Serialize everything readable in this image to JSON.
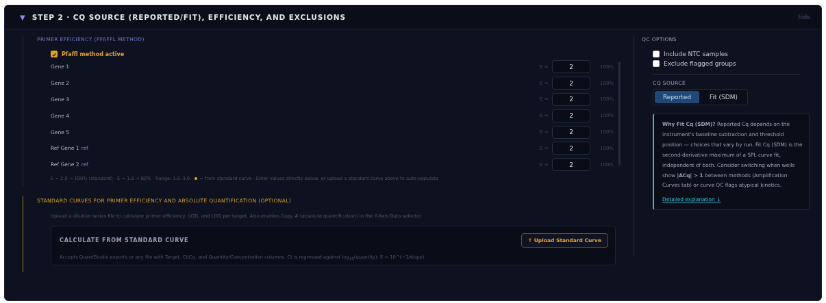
{
  "section": {
    "arrow": "▼",
    "title": "STEP 2 · CQ SOURCE (REPORTED/FIT), EFFICIENCY, AND EXCLUSIONS",
    "hide_link": "hide",
    "expanded": true
  },
  "primer_efficiency": {
    "heading": "PRIMER EFFICIENCY (PFAFFL METHOD)",
    "pfaffl": {
      "label": "Pfaffl method active",
      "checked": true
    },
    "genes": [
      {
        "name": "Gene 1",
        "e_label": "E =",
        "value": "2",
        "percent": "100%"
      },
      {
        "name": "Gene 2",
        "e_label": "E =",
        "value": "2",
        "percent": "100%"
      },
      {
        "name": "Gene 3",
        "e_label": "E =",
        "value": "2",
        "percent": "100%"
      },
      {
        "name": "Gene 4",
        "e_label": "E =",
        "value": "2",
        "percent": "100%"
      },
      {
        "name": "Gene 5",
        "e_label": "E =",
        "value": "2",
        "percent": "100%"
      },
      {
        "name": "Ref Gene 1",
        "tag": "ref",
        "e_label": "E =",
        "value": "2",
        "percent": "100%"
      },
      {
        "name": "Ref Gene 2",
        "tag": "ref",
        "e_label": "E =",
        "value": "2",
        "percent": "100%"
      }
    ],
    "note_before": "E = 2.0 → 100% (standard) · E = 1.8 → 80% · Range: 1.0–3.0 ·",
    "note_after": "= from standard curve · Enter values directly below, or upload a standard curve above to auto-populate"
  },
  "standard_curves": {
    "heading": "STANDARD CURVES FOR PRIMER EFFICIENCY AND ABSOLUTE QUANTIFICATION (OPTIONAL)",
    "description": "Upload a dilution series file to calculate primer efficiency, LOD, and LOQ per target. Also enables Copy # (absolute quantification) in the Y-Axis Data selector.",
    "card": {
      "title": "CALCULATE FROM STANDARD CURVE",
      "button": "↑ Upload Standard Curve",
      "text": "Accepts QuantStudio exports or any file with Target, Ct/Cq, and Quantity/Concentration columns. Ct is regressed against log$_{10}$(quantity); E = 10^(−1/slope)."
    }
  },
  "qc_options": {
    "heading": "QC OPTIONS",
    "checkboxes": [
      {
        "label": "Include NTC samples",
        "checked": false
      },
      {
        "label": "Exclude flagged groups",
        "checked": false
      }
    ],
    "cq_source": {
      "heading": "CQ SOURCE",
      "tabs": [
        {
          "label": "Reported",
          "selected": true
        },
        {
          "label": "Fit (SDM)",
          "selected": false
        }
      ]
    },
    "info": {
      "text": "**Why Fit Cq (SDM)?** Reported Cq depends on the instrument's baseline subtraction and threshold position — choices that vary by run. Fit Cq (SDM) is the second-derivative maximum of a 5PL curve fit, independent of both. Consider switching when wells show **|ΔCq| > 1** between methods (Amplification Curves tab) or curve QC flags atypical kinetics.",
      "link": "Detailed explanation ↓"
    }
  }
}
